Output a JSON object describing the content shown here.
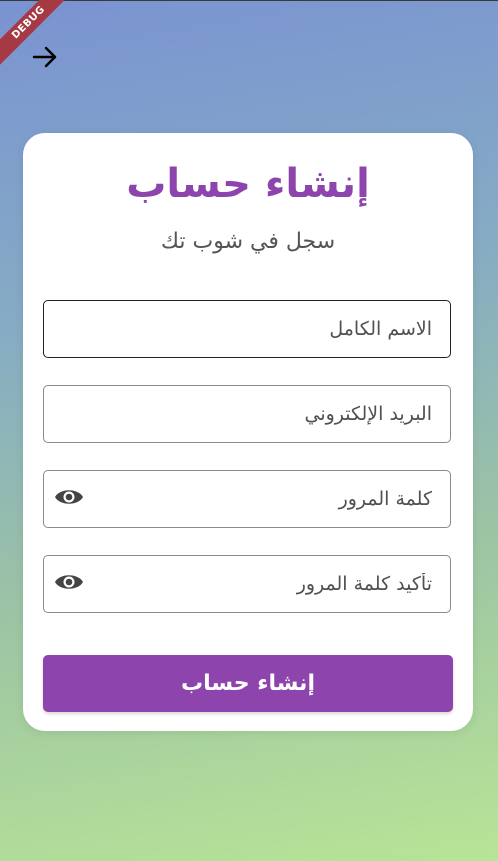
{
  "debug_banner": "DEBUG",
  "header": {
    "back_icon": "arrow-right-icon"
  },
  "form": {
    "title": "إنشاء حساب",
    "subtitle": "سجل في شوب تك",
    "fields": [
      {
        "placeholder": "الاسم الكامل",
        "value": ""
      },
      {
        "placeholder": "البريد الإلكتروني",
        "value": ""
      },
      {
        "placeholder": "كلمة المرور",
        "value": "",
        "icon": "eye-icon"
      },
      {
        "placeholder": "تأكيد كلمة المرور",
        "value": "",
        "icon": "eye-icon"
      }
    ],
    "submit_label": "إنشاء حساب"
  },
  "colors": {
    "accent": "#8e44ad",
    "debug_ribbon": "#a53a45",
    "gradient_top": "#7a93d2",
    "gradient_bottom": "#b8e496"
  }
}
